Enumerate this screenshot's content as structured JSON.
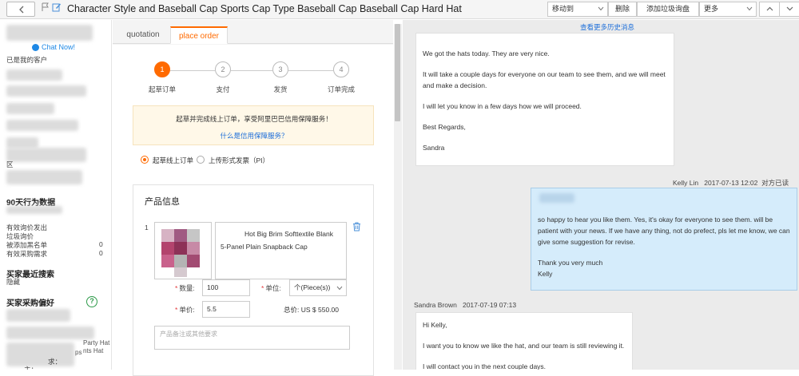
{
  "topbar": {
    "title": "Character Style and Baseball Cap Sports Cap Type Baseball Cap Baseball Cap Hard Hat",
    "move_to": "移动到",
    "delete": "删除",
    "add_spam": "添加垃圾询盘",
    "more": "更多"
  },
  "sidebar": {
    "chat_now": "Chat Now!",
    "customer_status": "已是我的客户",
    "section_label": "区",
    "behavior_title": "90天行为数据",
    "stats": [
      {
        "label": "有效询价发出",
        "value": ""
      },
      {
        "label": "垃圾询价",
        "value": ""
      },
      {
        "label": "被添加黑名单",
        "value": "0"
      },
      {
        "label": "有效采购需求",
        "value": "0"
      }
    ],
    "recent_search_title": "买家最近搜索",
    "recent_search_value": "隐藏",
    "preference_title": "买家采购偏好",
    "preference_icon": "?",
    "hat_fragment_1": "Party Hat",
    "hat_fragment_2": "nts Hat",
    "hat_fragment_3": "ps",
    "buyer_req": "求：",
    "trade_type": "主："
  },
  "order": {
    "tabs": [
      "quotation",
      "place order"
    ],
    "steps": [
      {
        "num": "1",
        "label": "起草订单"
      },
      {
        "num": "2",
        "label": "支付"
      },
      {
        "num": "3",
        "label": "发货"
      },
      {
        "num": "4",
        "label": "订单完成"
      }
    ],
    "notice_main": "起草并完成线上订单，享受阿里巴巴信用保障服务！",
    "notice_link": "什么是信用保障服务？",
    "radio_online": "起草线上订单",
    "radio_pi": "上传形式发票（PI）",
    "product_header": "产品信息",
    "product_index": "1",
    "product_name_line1": "Hot Big Brim Softtextile Blank",
    "product_name_line2": "5-Panel Plain Snapback Cap",
    "qty_label": "数量:",
    "qty_value": "100",
    "unit_label": "单位:",
    "unit_value": "个(Piece(s))",
    "price_label": "单价:",
    "price_value": "5.5",
    "total_label": "总价:",
    "total_value": "US $ 550.00",
    "remark_placeholder": "产品备注或其他要求"
  },
  "chat": {
    "history_link": "查看更多历史消息",
    "messages": [
      {
        "sender": "",
        "time": "",
        "lines": [
          "We got the hats today. They are very nice.",
          "It will take a couple days for everyone on our team to see them, and we will meet and make a decision.",
          "I will let you know in a few days how we will proceed.",
          "Best Regards,",
          "Sandra"
        ]
      },
      {
        "sender": "Kelly Lin",
        "time": "2017-07-13 12:02",
        "status": "对方已读",
        "lines": [
          "so happy to hear you like them. Yes, it's okay for everyone to see them. will be patient with your news.  If we have any thing, not do prefect, pls let me know, we can give some suggestion for revise.",
          "Thank you very much",
          "Kelly"
        ]
      },
      {
        "sender": "Sandra Brown",
        "time": "2017-07-19 07:13",
        "lines": [
          "Hi Kelly,",
          "I want you to know we like the hat, and our team is still reviewing it.",
          "I will contact you in the next couple days."
        ]
      }
    ]
  },
  "colors": {
    "accent": "#ff6a00",
    "link": "#1e6fd9",
    "my_bubble": "#d5ecfb"
  }
}
